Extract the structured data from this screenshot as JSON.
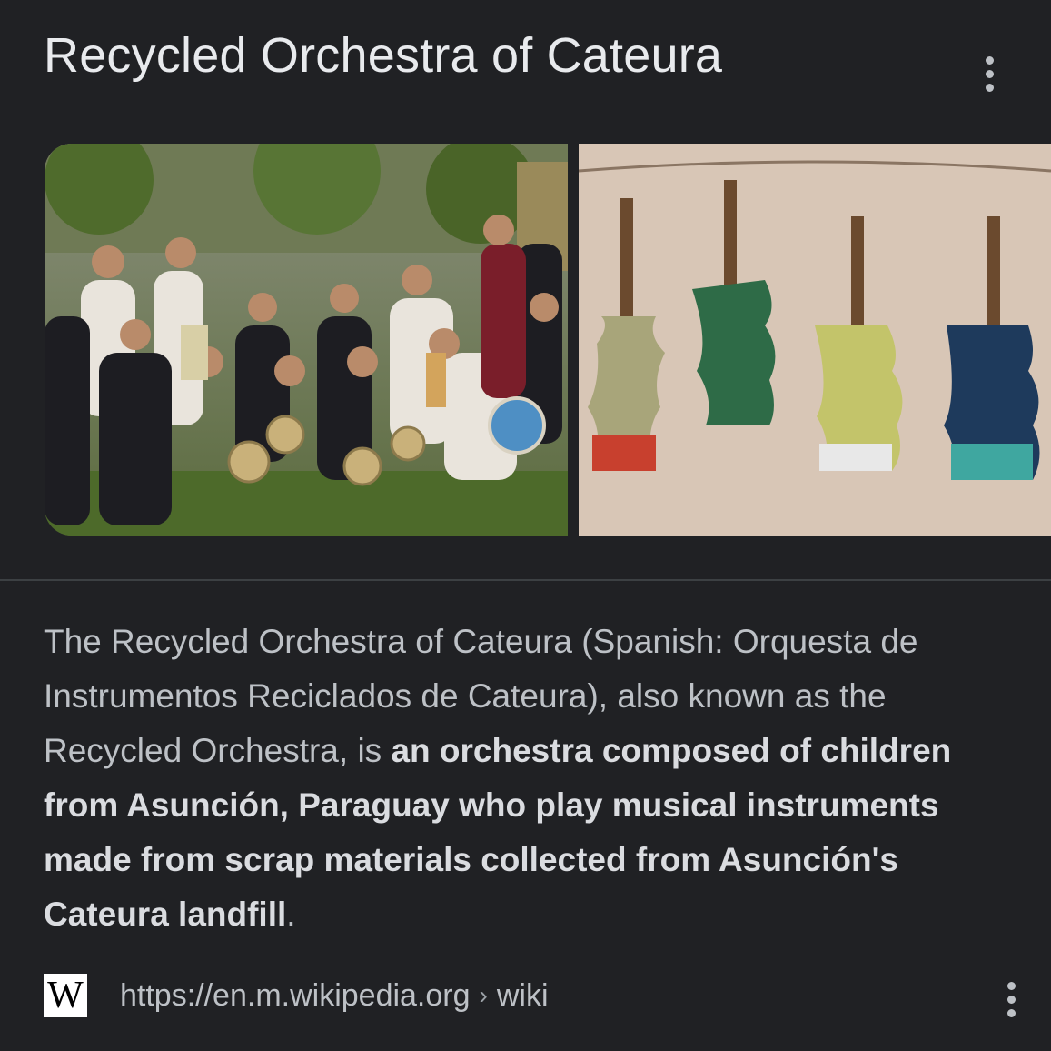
{
  "header": {
    "title": "Recycled Orchestra of Cateura",
    "more_menu_icon": "more-vert-icon"
  },
  "images": [
    {
      "name": "group-photo",
      "subject": "orchestra-members-with-instruments"
    },
    {
      "name": "violins-photo",
      "subject": "recycled-violins-hanging"
    }
  ],
  "description": {
    "part1": "The Recycled Orchestra of Cateura (Spanish: Orquesta de Instrumentos Reciclados de Cateura), also known as the Recycled Orchestra, is ",
    "bold": "an orchestra composed of children from Asunción, Paraguay who play musical instruments made from scrap materials collected from Asunción's Cateura landfill",
    "part2": "."
  },
  "source": {
    "logo_letter": "W",
    "url": "https://en.m.wikipedia.org",
    "separator": "›",
    "path": "wiki",
    "more_menu_icon": "more-vert-icon"
  },
  "colors": {
    "background": "#202124",
    "title": "#e8eaed",
    "body_text": "#bdc1c6",
    "divider": "#3c4043"
  }
}
